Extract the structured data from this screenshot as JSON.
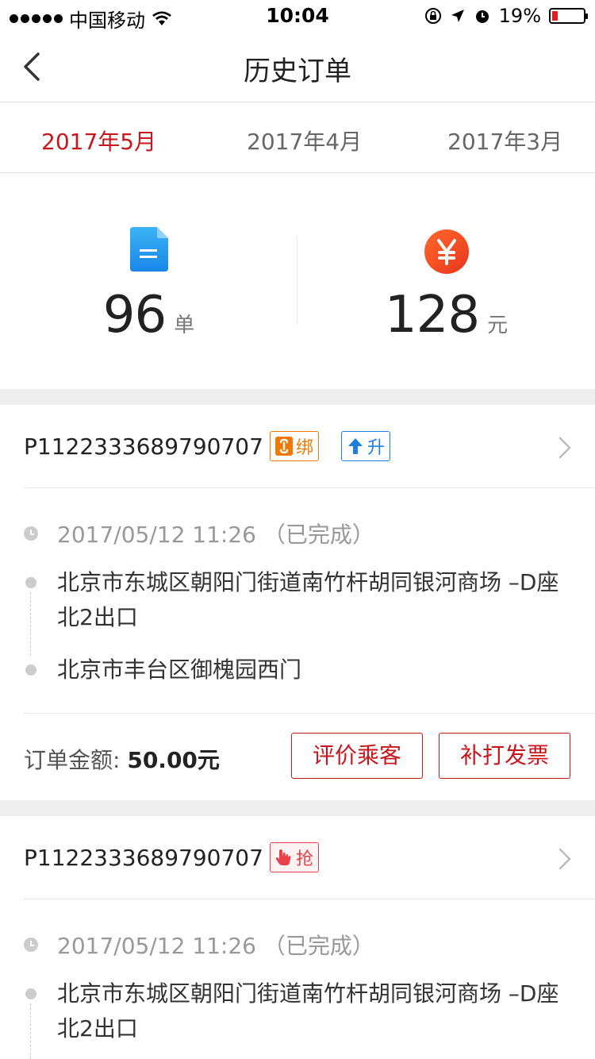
{
  "status_bar": {
    "carrier": "中国移动",
    "time": "10:04",
    "battery": "19%",
    "battery_level": 0.19
  },
  "nav": {
    "title": "历史订单"
  },
  "tabs": [
    {
      "label": "2017年5月",
      "active": true
    },
    {
      "label": "2017年4月",
      "active": false
    },
    {
      "label": "2017年3月",
      "active": false
    }
  ],
  "stats": {
    "orders": {
      "value": "96",
      "unit": "单",
      "icon": "document-icon"
    },
    "income": {
      "value": "128",
      "unit": "元",
      "icon": "yuan-icon"
    }
  },
  "orders": [
    {
      "id": "P1122333689790707",
      "badges": [
        {
          "label": "绑",
          "icon": "bind-icon",
          "color": "#f07800"
        },
        {
          "label": "升",
          "icon": "upgrade-arrow-icon",
          "color": "#1f7fe0"
        }
      ],
      "time": "2017/05/12   11:26  （已完成）",
      "from": "北京市东城区朝阳门街道南竹杆胡同银河商场 –D座北2出口",
      "to": "北京市丰台区御槐园西门",
      "amount_label": "订单金额: ",
      "amount": "50.00元",
      "actions": [
        "评价乘客",
        "补打发票"
      ]
    },
    {
      "id": "P1122333689790707",
      "badges": [
        {
          "label": "抢",
          "icon": "grab-hand-icon",
          "color": "#e8414b"
        }
      ],
      "time": "2017/05/12   11:26  （已完成）",
      "from": "北京市东城区朝阳门街道南竹杆胡同银河商场 –D座北2出口"
    }
  ],
  "colors": {
    "accent": "#c8161d",
    "divider": "#e6e6e6",
    "background_gap": "#efefef"
  }
}
